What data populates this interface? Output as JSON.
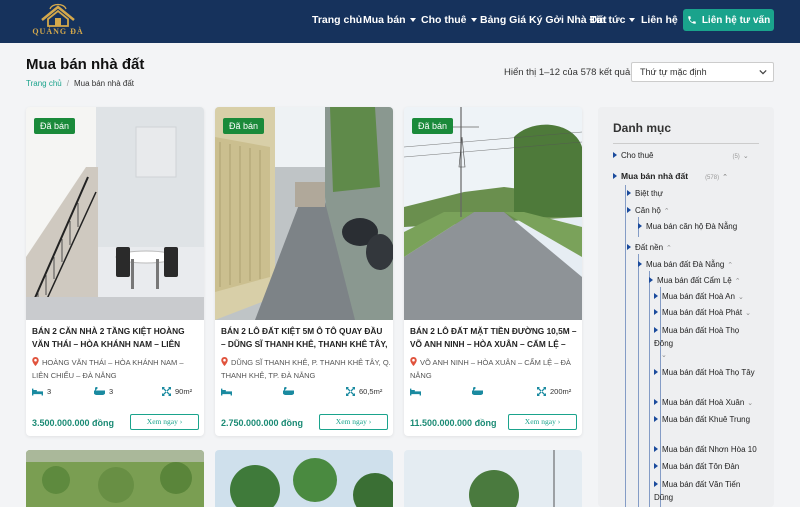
{
  "brand": {
    "name": "QUẢNG ĐÀ",
    "color": "#d4a84b"
  },
  "nav": {
    "items": [
      "Trang chủ",
      "Mua bán",
      "Cho thuê",
      "Bảng Giá Ký Gởi Nhà Đất",
      "Tin tức",
      "Liên hệ"
    ],
    "contact_label": "Liên hệ tư vấn"
  },
  "page": {
    "title": "Mua bán nhà đất",
    "breadcrumb_home": "Trang chủ",
    "breadcrumb_current": "Mua bán nhà đất"
  },
  "results": {
    "count_text": "Hiển thị 1–12 của 578 kết quả",
    "sort_selected": "Thứ tự mặc định"
  },
  "listings": [
    {
      "badge": "Đã bán",
      "title": "BÁN 2 CĂN NHÀ 2 TẦNG KIỆT HOÀNG VĂN THÁI – HÒA KHÁNH NAM – LIÊN CHIỂU –",
      "location": "HOÀNG VĂN THÁI – HÒA KHÁNH NAM – LIÊN CHIỂU – ĐÀ NẴNG",
      "beds": "3",
      "baths": "3",
      "area": "90m²",
      "price": "3.500.000.000 đồng",
      "cta": "Xem ngay ›"
    },
    {
      "badge": "Đã bán",
      "title": "BÁN 2 LÔ ĐẤT KIỆT 5M Ô TÔ QUAY ĐẦU – DŨNG SĨ THANH KHÊ, THANH KHÊ TÂY, TP.",
      "location": "DŨNG SĨ THANH KHÊ, P. THANH KHÊ TÂY, Q. THANH KHÊ, TP. ĐÀ NẴNG",
      "beds": "",
      "baths": "",
      "area": "60,5m²",
      "price": "2.750.000.000 đồng",
      "cta": "Xem ngay ›"
    },
    {
      "badge": "Đã bán",
      "title": "BÁN 2 LÔ ĐẤT MẶT TIỀN ĐƯỜNG 10,5M – VÕ ANH NINH – HÒA XUÂN – CẨM LỆ – ĐÀ",
      "location": "VÕ ANH NINH – HÒA XUÂN – CẨM LỆ – ĐÀ NẴNG",
      "beds": "",
      "baths": "",
      "area": "200m²",
      "price": "11.500.000.000 đồng",
      "cta": "Xem ngay ›"
    }
  ],
  "sidebar": {
    "title": "Danh mục",
    "cho_thue": {
      "label": "Cho thuê",
      "count": "(5)"
    },
    "mua_ban": {
      "label": "Mua bán nhà đất",
      "count": "(578)"
    },
    "biet_thu": "Biệt thự",
    "can_ho": "Căn hộ",
    "can_ho_dn": "Mua bán căn hộ Đà Nẵng",
    "dat_nen": "Đất nền",
    "dat_dn": "Mua bán đất Đà Nẵng",
    "dat_cam_le": "Mua bán đất Cẩm Lệ",
    "sub": [
      "Mua bán đất Hoà An",
      "Mua bán đất Hoà Phát",
      "Mua bán đất Hoà Thọ Đông",
      "Mua bán đất Hoà Thọ Tây",
      "Mua bán đất Hoà Xuân",
      "Mua bán đất Khuê Trung",
      "Mua bán đất Nhơn Hòa 10",
      "Mua bán đất Tôn Đản",
      "Mua bán đất Văn Tiến Dũng"
    ]
  },
  "colors": {
    "header": "#16325c",
    "accent": "#1aa38c",
    "sold_badge": "#1a8a3a"
  }
}
